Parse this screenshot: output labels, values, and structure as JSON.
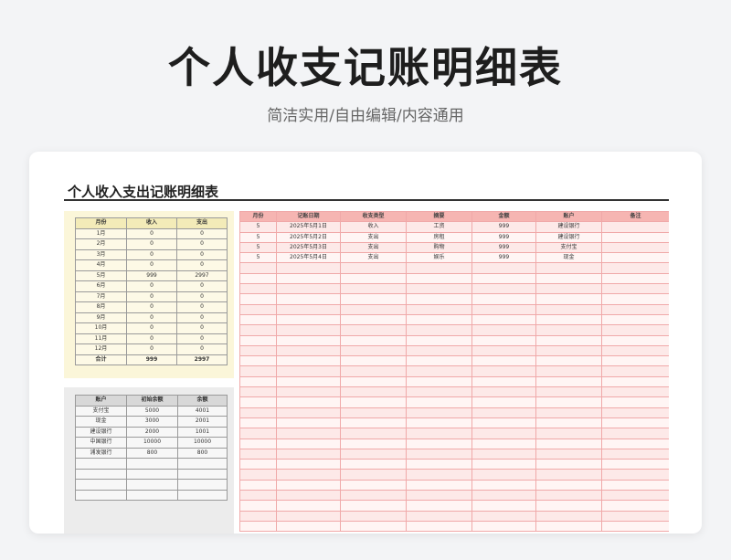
{
  "hero": {
    "title": "个人收支记账明细表",
    "subtitle": "简洁实用/自由编辑/内容通用"
  },
  "sheet": {
    "title": "个人收入支出记账明细表"
  },
  "monthly": {
    "headers": [
      "月份",
      "收入",
      "支出"
    ],
    "rows": [
      [
        "1月",
        "0",
        "0"
      ],
      [
        "2月",
        "0",
        "0"
      ],
      [
        "3月",
        "0",
        "0"
      ],
      [
        "4月",
        "0",
        "0"
      ],
      [
        "5月",
        "999",
        "2997"
      ],
      [
        "6月",
        "0",
        "0"
      ],
      [
        "7月",
        "0",
        "0"
      ],
      [
        "8月",
        "0",
        "0"
      ],
      [
        "9月",
        "0",
        "0"
      ],
      [
        "10月",
        "0",
        "0"
      ],
      [
        "11月",
        "0",
        "0"
      ],
      [
        "12月",
        "0",
        "0"
      ]
    ],
    "total": [
      "合计",
      "999",
      "2997"
    ]
  },
  "accounts": {
    "headers": [
      "账户",
      "初始余额",
      "余额"
    ],
    "rows": [
      [
        "支付宝",
        "5000",
        "4001"
      ],
      [
        "现金",
        "3000",
        "2001"
      ],
      [
        "建设银行",
        "2000",
        "1001"
      ],
      [
        "中国银行",
        "10000",
        "10000"
      ],
      [
        "浦发银行",
        "800",
        "800"
      ],
      [
        "",
        "",
        ""
      ],
      [
        "",
        "",
        ""
      ],
      [
        "",
        "",
        ""
      ],
      [
        "",
        "",
        ""
      ]
    ]
  },
  "ledger": {
    "headers": [
      "月份",
      "记账日期",
      "收支类型",
      "摘要",
      "金额",
      "账户",
      "备注"
    ],
    "rows": [
      [
        "5",
        "2025年5月1日",
        "收入",
        "工资",
        "999",
        "建设银行",
        ""
      ],
      [
        "5",
        "2025年5月2日",
        "支出",
        "房租",
        "999",
        "建设银行",
        ""
      ],
      [
        "5",
        "2025年5月3日",
        "支出",
        "购物",
        "999",
        "支付宝",
        ""
      ],
      [
        "5",
        "2025年5月4日",
        "支出",
        "娱乐",
        "999",
        "现金",
        ""
      ]
    ],
    "empty_rows": 26
  }
}
